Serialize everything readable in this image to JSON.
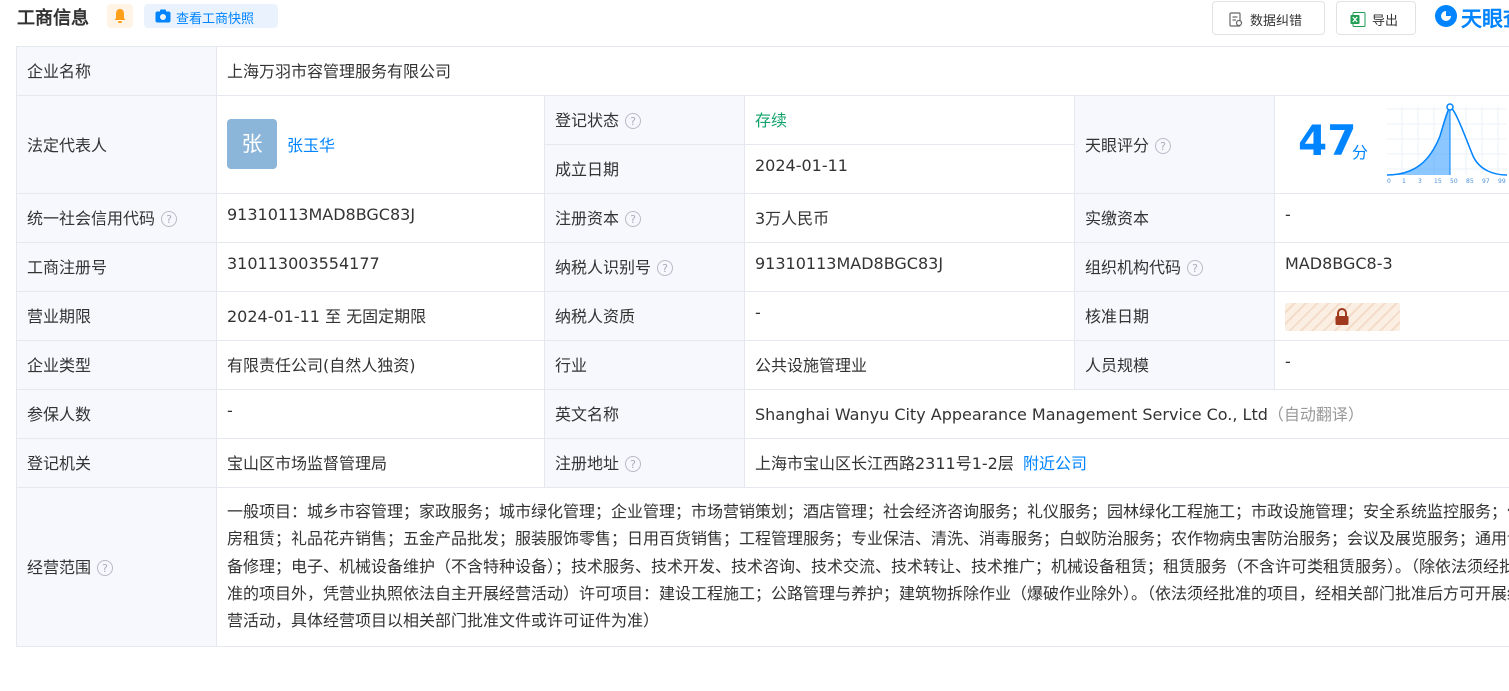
{
  "header": {
    "title": "工商信息",
    "snapshot_label": "查看工商快照",
    "correct_label": "数据纠错",
    "export_label": "导出",
    "brand_label": "天眼查"
  },
  "colors": {
    "accent": "#0084ff",
    "label_bg": "#f6f8fd",
    "border": "#e6e8ef",
    "status_green": "#12a36a",
    "bell_orange": "#ff9f1a"
  },
  "icons": {
    "bell": "bell-icon",
    "camera": "camera-icon",
    "correct": "edit-doc-icon",
    "export": "excel-icon",
    "brand": "tianyancha-logo",
    "help": "question-circle-icon",
    "lock": "lock-icon"
  },
  "company": {
    "name_label": "企业名称",
    "name": "上海万羽市容管理服务有限公司",
    "legal_rep_label": "法定代表人",
    "legal_rep_avatar": "张",
    "legal_rep": "张玉华",
    "status_label": "登记状态",
    "status": "存续",
    "est_date_label": "成立日期",
    "est_date": "2024-01-11",
    "score_label": "天眼评分",
    "score": "47",
    "score_unit": "分",
    "score_chart_ticks": [
      "0",
      "1",
      "3",
      "15",
      "50",
      "85",
      "97",
      "99"
    ],
    "credit_code_label": "统一社会信用代码",
    "credit_code": "91310113MAD8BGC83J",
    "reg_capital_label": "注册资本",
    "reg_capital": "3万人民币",
    "paid_capital_label": "实缴资本",
    "paid_capital": "-",
    "reg_no_label": "工商注册号",
    "reg_no": "310113003554177",
    "taxpayer_id_label": "纳税人识别号",
    "taxpayer_id": "91310113MAD8BGC83J",
    "org_code_label": "组织机构代码",
    "org_code": "MAD8BGC8-3",
    "term_label": "营业期限",
    "term": "2024-01-11 至 无固定期限",
    "taxpayer_qual_label": "纳税人资质",
    "taxpayer_qual": "-",
    "approval_date_label": "核准日期",
    "type_label": "企业类型",
    "type": "有限责任公司(自然人独资)",
    "industry_label": "行业",
    "industry": "公共设施管理业",
    "staff_label": "人员规模",
    "staff": "-",
    "insured_label": "参保人数",
    "insured": "-",
    "en_name_label": "英文名称",
    "en_name": "Shanghai Wanyu City Appearance Management Service Co., Ltd",
    "en_name_note": "（自动翻译）",
    "authority_label": "登记机关",
    "authority": "宝山区市场监督管理局",
    "address_label": "注册地址",
    "address": "上海市宝山区长江西路2311号1-2层",
    "nearby_label": "附近公司",
    "scope_label": "经营范围",
    "scope": "一般项目：城乡市容管理；家政服务；城市绿化管理；企业管理；市场营销策划；酒店管理；社会经济咨询服务；礼仪服务；园林绿化工程施工；市政设施管理；安全系统监控服务；住房租赁；礼品花卉销售；五金产品批发；服装服饰零售；日用百货销售；工程管理服务；专业保洁、清洗、消毒服务；白蚁防治服务；农作物病虫害防治服务；会议及展览服务；通用设备修理；电子、机械设备维护（不含特种设备）；技术服务、技术开发、技术咨询、技术交流、技术转让、技术推广；机械设备租赁；租赁服务（不含许可类租赁服务）。（除依法须经批准的项目外，凭营业执照依法自主开展经营活动）许可项目：建设工程施工；公路管理与养护；建筑物拆除作业（爆破作业除外）。（依法须经批准的项目，经相关部门批准后方可开展经营活动，具体经营项目以相关部门批准文件或许可证件为准）"
  }
}
